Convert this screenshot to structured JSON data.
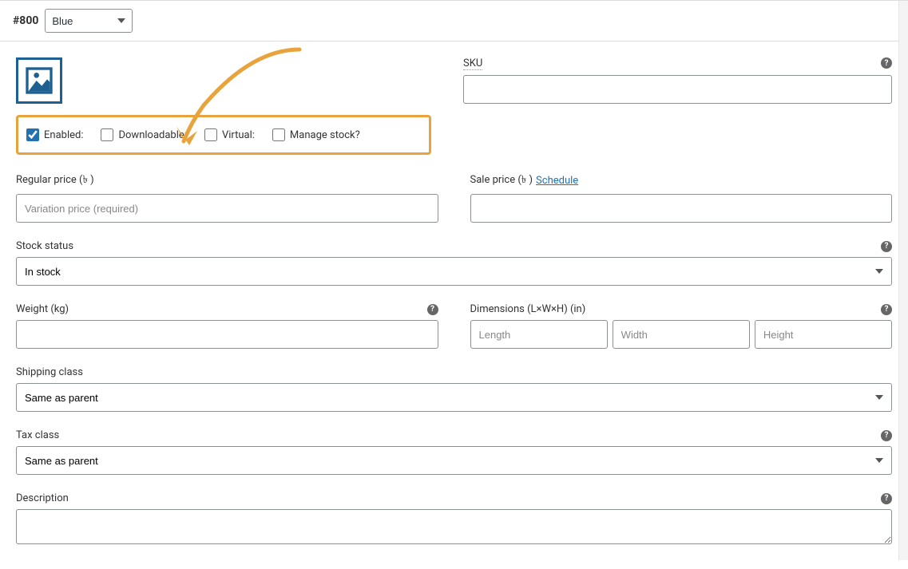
{
  "header": {
    "variation_id": "#800",
    "attribute_selected": "Blue"
  },
  "checkboxes": {
    "enabled_label": "Enabled:",
    "downloadable_label": "Downloadable:",
    "virtual_label": "Virtual:",
    "manage_stock_label": "Manage stock?"
  },
  "fields": {
    "sku_label": "SKU",
    "regular_price_label": "Regular price (৳ )",
    "regular_price_placeholder": "Variation price (required)",
    "sale_price_label": "Sale price (৳ )",
    "schedule_link": "Schedule",
    "stock_status_label": "Stock status",
    "stock_status_value": "In stock",
    "weight_label": "Weight (kg)",
    "dimensions_label": "Dimensions (L×W×H) (in)",
    "length_placeholder": "Length",
    "width_placeholder": "Width",
    "height_placeholder": "Height",
    "shipping_class_label": "Shipping class",
    "shipping_class_value": "Same as parent",
    "tax_class_label": "Tax class",
    "tax_class_value": "Same as parent",
    "description_label": "Description"
  }
}
